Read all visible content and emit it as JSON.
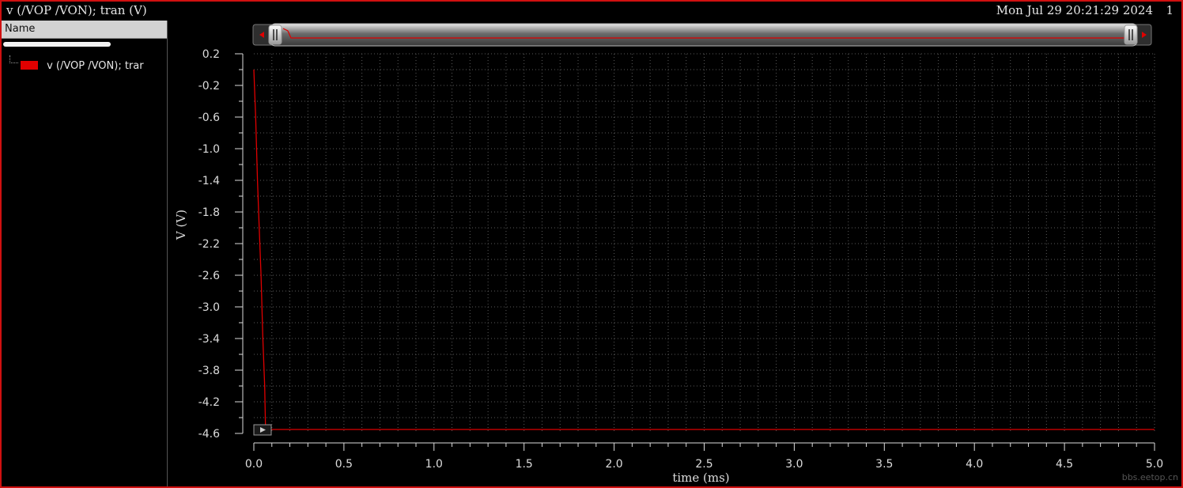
{
  "window": {
    "title": "v (/VOP /VON); tran (V)",
    "datetime": "Mon Jul 29 20:21:29 2024",
    "page_number": "1"
  },
  "sidebar": {
    "header": "Name",
    "trace_label": "v (/VOP /VON); trar",
    "trace_color": "#e00000"
  },
  "watermark": "bbs.eetop.cn",
  "colors": {
    "frame": "#d01010",
    "grid": "#5a5a5a",
    "trace": "#e00000",
    "axis": "#dcdcdc"
  },
  "chart_data": {
    "type": "line",
    "title": "v (/VOP /VON); tran (V)",
    "xlabel": "time (ms)",
    "ylabel": "V (V)",
    "xlim": [
      0,
      5
    ],
    "ylim": [
      -4.6,
      0.2
    ],
    "x_ticks": [
      "0.0",
      "0.5",
      "1.0",
      "1.5",
      "2.0",
      "2.5",
      "3.0",
      "3.5",
      "4.0",
      "4.5",
      "5.0"
    ],
    "y_ticks": [
      "0.2",
      "-0.2",
      "-0.6",
      "-1.0",
      "-1.4",
      "-1.8",
      "-2.2",
      "-2.6",
      "-3.0",
      "-3.4",
      "-3.8",
      "-4.2",
      "-4.6"
    ],
    "grid": true,
    "legend": "left-panel",
    "series": [
      {
        "name": "v (/VOP /VON); tran",
        "color": "#e00000",
        "x": [
          0.0,
          0.01,
          0.02,
          0.03,
          0.04,
          0.05,
          0.06,
          0.065,
          5.0
        ],
        "y": [
          0.0,
          -0.6,
          -1.4,
          -2.0,
          -2.6,
          -3.4,
          -4.0,
          -4.55,
          -4.55
        ]
      }
    ]
  }
}
